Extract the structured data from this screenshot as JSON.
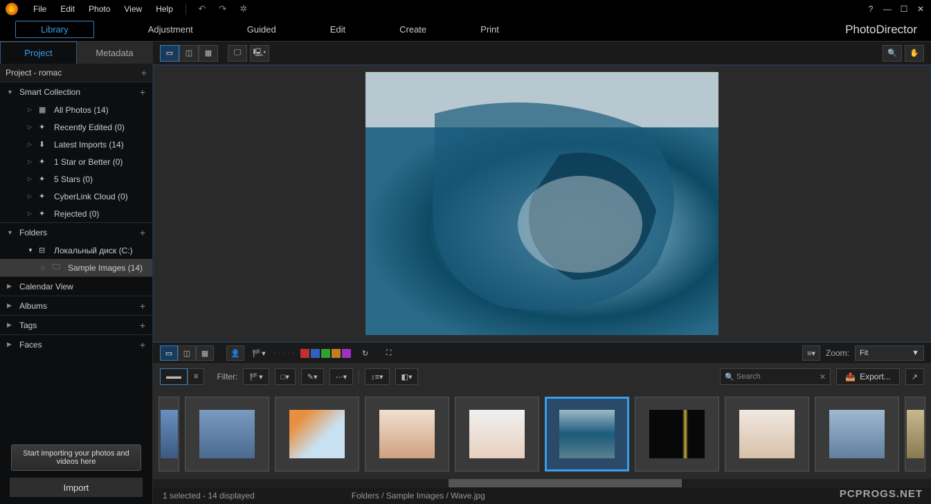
{
  "menubar": [
    "File",
    "Edit",
    "Photo",
    "View",
    "Help"
  ],
  "modules": {
    "items": [
      "Library",
      "Adjustment",
      "Guided",
      "Edit",
      "Create",
      "Print"
    ],
    "active": "Library"
  },
  "brand": "PhotoDirector",
  "side_tabs": {
    "items": [
      "Project",
      "Metadata"
    ],
    "active": "Project"
  },
  "project_header": "Project - romac",
  "smart_collection": {
    "title": "Smart Collection",
    "items": [
      "All Photos (14)",
      "Recently Edited (0)",
      "Latest Imports (14)",
      "1 Star or Better (0)",
      "5 Stars (0)",
      "CyberLink Cloud (0)",
      "Rejected (0)"
    ]
  },
  "folders": {
    "title": "Folders",
    "drive": "Локальный диск (C:)",
    "sample": "Sample Images (14)"
  },
  "sections": [
    "Calendar View",
    "Albums",
    "Tags",
    "Faces"
  ],
  "tooltip": "Start importing your photos and videos here",
  "import_btn": "Import",
  "midbar": {
    "colors": [
      "#c03030",
      "#3060c0",
      "#30a030",
      "#c08020",
      "#a030c0"
    ],
    "zoom_label": "Zoom:",
    "zoom_value": "Fit"
  },
  "filterbar": {
    "filter_label": "Filter:",
    "search_placeholder": "Search",
    "export_label": "Export..."
  },
  "thumbnails": [
    {
      "bg": "linear-gradient(#7a9ac0,#4a6a90)"
    },
    {
      "bg": "linear-gradient(135deg,#e89040 20%,#c8e0f0 60%)"
    },
    {
      "bg": "linear-gradient(#f0e0d0,#d0a080)"
    },
    {
      "bg": "linear-gradient(#f0f0f0,#e8d0c0)"
    },
    {
      "bg": "linear-gradient(180deg,#9db8c8,#1a5a7a 50%,#5a8090)",
      "selected": true
    },
    {
      "bg": "linear-gradient(90deg,#080808 60%,#c8b040 65%,#080808 70%)"
    },
    {
      "bg": "linear-gradient(#f0e8e0,#d8c0a8)"
    },
    {
      "bg": "linear-gradient(#a0b8d0,#6080a0)"
    }
  ],
  "status": {
    "selection": "1 selected - 14 displayed",
    "path": "Folders / Sample Images / Wave.jpg"
  },
  "watermark": "PCPROGS.NET"
}
